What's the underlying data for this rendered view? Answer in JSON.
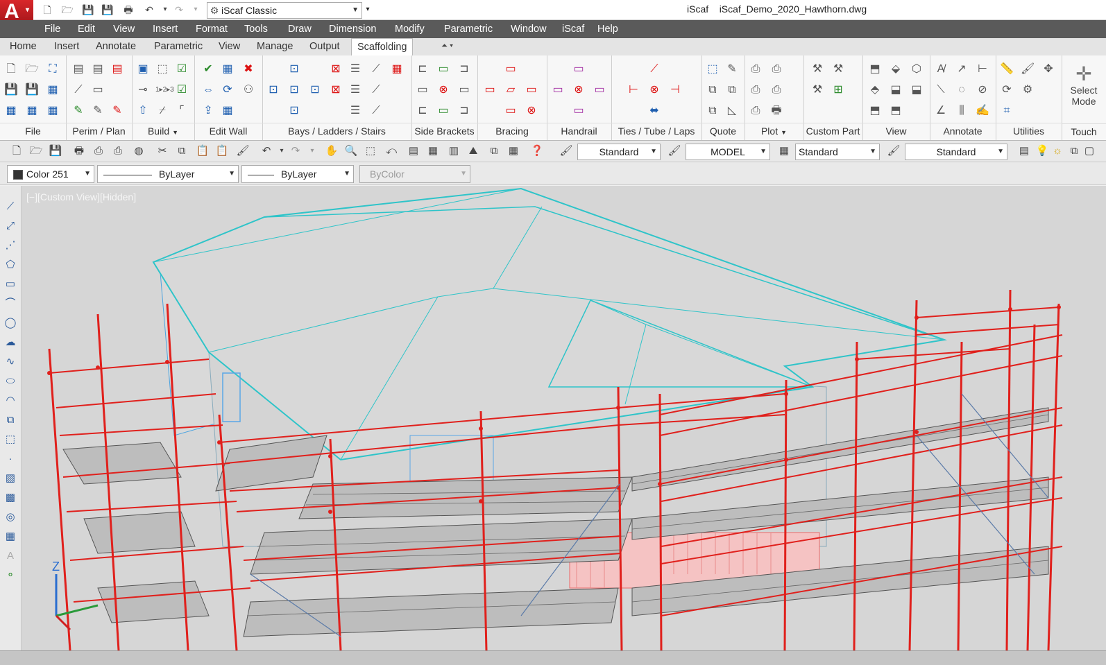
{
  "app": {
    "logo": "A",
    "title_app": "iScaf",
    "title_file": "iScaf_Demo_2020_Hawthorn.dwg"
  },
  "quick_access": {
    "workspace": "iScaf Classic"
  },
  "menu": [
    "File",
    "Edit",
    "View",
    "Insert",
    "Format",
    "Tools",
    "Draw",
    "Dimension",
    "Modify",
    "Parametric",
    "Window",
    "iScaf",
    "Help"
  ],
  "ribbon_tabs": [
    "Home",
    "Insert",
    "Annotate",
    "Parametric",
    "View",
    "Manage",
    "Output",
    "Scaffolding"
  ],
  "active_tab": "Scaffolding",
  "panels": [
    "File",
    "Perim / Plan",
    "Build",
    "Edit Wall",
    "Bays /  Ladders / Stairs",
    "Side Brackets",
    "Bracing",
    "Handrail",
    "Ties / Tube / Laps",
    "Quote",
    "Plot",
    "Custom Part",
    "View",
    "Annotate",
    "Utilities",
    "Touch"
  ],
  "select_mode": {
    "line1": "Select",
    "line2": "Mode"
  },
  "toolbar1": {
    "text_style": "Standard",
    "layout": "MODEL",
    "dim_style": "Standard",
    "table_style": "Standard"
  },
  "toolbar2": {
    "color": "Color 251",
    "linetype": "ByLayer",
    "lineweight": "ByLayer",
    "plotstyle": "ByColor"
  },
  "viewport": {
    "label": "[−][Custom View][Hidden]",
    "axis_z": "Z"
  },
  "colors": {
    "roof": "#2ec4c9",
    "scaffold": "#e0201c",
    "deck": "#6e6e6e",
    "menubar": "#5a5a5a"
  }
}
